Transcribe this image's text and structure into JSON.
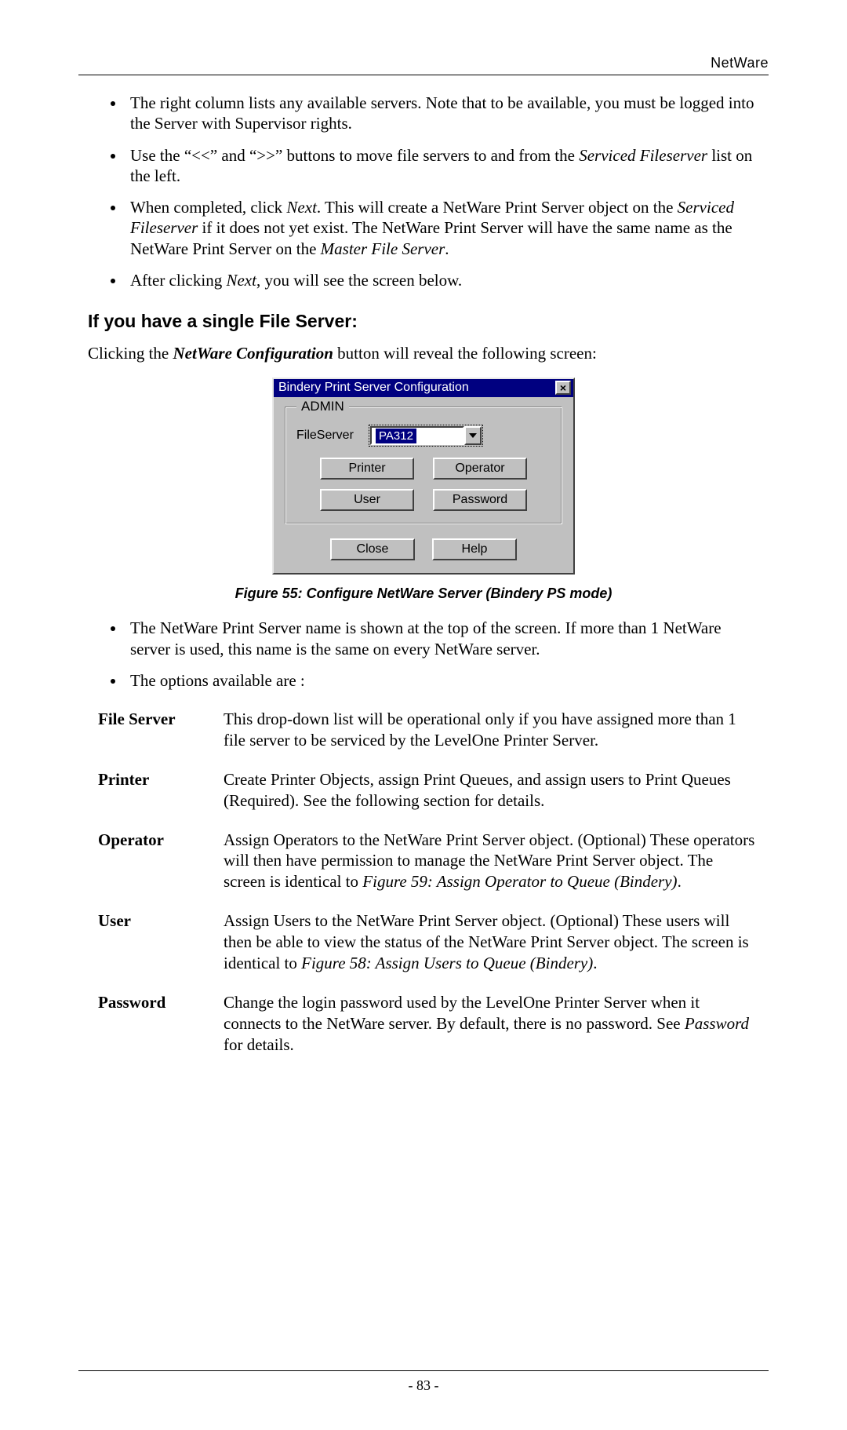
{
  "header": {
    "right": "NetWare"
  },
  "bullets_top": [
    "The right column lists any available servers. Note that to be available, you must be logged into the Server with Supervisor rights.",
    "Use the \"<<\" and \">>\" buttons to move file servers to and from the Serviced Fileserver list on the left.",
    "When completed, click Next. This will create a NetWare Print Server object on the Serviced Fileserver if it does not yet exist. The NetWare Print Server will have the same name as the NetWare Print Server on the Master File Server.",
    "After clicking Next, you will see the screen below."
  ],
  "section_heading": "If you have a single File Server:",
  "section_intro_pre": "Clicking the ",
  "section_intro_bold": "NetWare Configuration",
  "section_intro_post": " button will reveal the following screen:",
  "dialog": {
    "title": "Bindery Print Server Configuration",
    "close": "×",
    "group_legend": "ADMIN",
    "fileserver_label": "FileServer",
    "fileserver_value": "PA312",
    "buttons": {
      "printer": "Printer",
      "operator": "Operator",
      "user": "User",
      "password": "Password",
      "close": "Close",
      "help": "Help"
    }
  },
  "figure_caption": "Figure 55: Configure NetWare Server (Bindery PS mode)",
  "bullets_mid": [
    "The NetWare Print Server name is shown at the top of the screen. If more than 1 NetWare server is used, this name is the same on every NetWare server.",
    "The options available are :"
  ],
  "definitions": [
    {
      "term": "File Server",
      "desc": "This drop-down list will be operational only if you have assigned more than 1 file server to be serviced by the LevelOne Printer Server."
    },
    {
      "term": "Printer",
      "desc": "Create Printer Objects, assign Print Queues, and assign users to Print Queues (Required). See the following section for details."
    },
    {
      "term": "Operator",
      "desc": "Assign Operators to the NetWare Print Server object. (Optional) These operators will then have permission to manage the NetWare Print Server object. The screen is identical to Figure 59: Assign Operator to Queue (Bindery)."
    },
    {
      "term": "User",
      "desc": "Assign Users to the NetWare Print Server object. (Optional) These users will then be able to view the status of the NetWare Print Server object. The screen is identical to Figure 58: Assign Users to Queue (Bindery)."
    },
    {
      "term": "Password",
      "desc": "Change the login password used by the LevelOne Printer Server when it connects to the NetWare server. By default, there is no password. See Password for details."
    }
  ],
  "page_number": "- 83 -"
}
